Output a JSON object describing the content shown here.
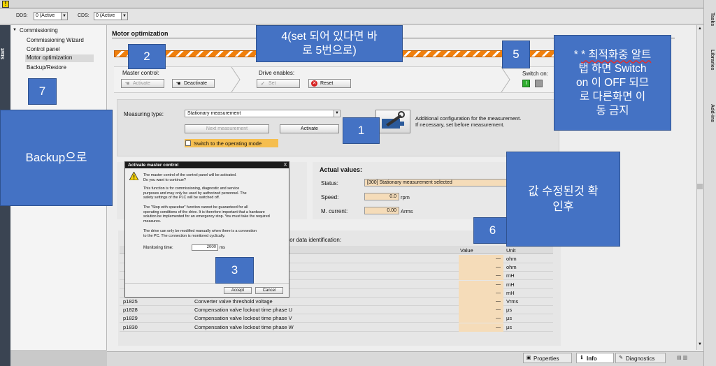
{
  "dds": {
    "label": "DDS:",
    "value": "0 (Active"
  },
  "cds": {
    "label": "CDS:",
    "value": "0 (Active"
  },
  "start_label": "Start",
  "nav": {
    "root": "Commissioning",
    "items": [
      "Commissioning Wizard",
      "Control panel",
      "Motor optimization",
      "Backup/Restore"
    ],
    "selected_index": 2
  },
  "main": {
    "title": "Motor optimization",
    "master_control_label": "Master control:",
    "activate_label": "Activate",
    "deactivate_label": "Deactivate",
    "drive_enables_label": "Drive enables:",
    "set_label": "Set",
    "reset_label": "Reset",
    "switch_on_label": "Switch on:"
  },
  "measurement": {
    "measuring_type_label": "Measuring type:",
    "measuring_type_value": "Stationary measurement",
    "next_measurement_label": "Next measurement",
    "activate_label": "Activate",
    "switch_operating_label": "Switch to the operating mode",
    "info_line1": "Additional configuration for the measurement.",
    "info_line2": "If necessary, set before measurement."
  },
  "actual": {
    "heading": "Actual values:",
    "status_label": "Status:",
    "status_value": "[300] Stationary measurement selected",
    "speed_label": "Speed:",
    "speed_value": "0.0",
    "speed_unit": "rpm",
    "current_label": "M. current:",
    "current_value": "0.00",
    "current_unit": "Arms"
  },
  "table": {
    "partial_heading": "tor data identification:",
    "col_value": "Value",
    "col_unit": "Unit",
    "rows": [
      {
        "param": "",
        "desc": "",
        "value": "—",
        "unit": "ohm"
      },
      {
        "param": "",
        "desc": "",
        "value": "—",
        "unit": "ohm"
      },
      {
        "param": "",
        "desc": "",
        "value": "—",
        "unit": "mH"
      },
      {
        "param": "",
        "desc": "",
        "value": "—",
        "unit": "mH"
      },
      {
        "param": "",
        "desc": "",
        "value": "—",
        "unit": "mH"
      },
      {
        "param": "p1825",
        "desc": "Converter valve threshold voltage",
        "value": "—",
        "unit": "Vrms"
      },
      {
        "param": "p1828",
        "desc": "Compensation valve lockout time phase U",
        "value": "—",
        "unit": "μs"
      },
      {
        "param": "p1829",
        "desc": "Compensation valve lockout time phase V",
        "value": "—",
        "unit": "μs"
      },
      {
        "param": "p1830",
        "desc": "Compensation valve lockout time phase W",
        "value": "—",
        "unit": "μs"
      }
    ]
  },
  "dialog": {
    "title": "Activate master control",
    "close": "X",
    "line1": "The master control of the control panel will be activated.",
    "line2": "Do you want to continue?",
    "p1a": "This function is for commissioning, diagnostic and service",
    "p1b": "purposes and may only be used by authorized personnel. The",
    "p1c": "safety settings of the PLC will be switched off.",
    "p2a": "The \"Stop with spacebar\" function cannot be guaranteed for all",
    "p2b": "operating conditions of the drive. It is therefore important that a hardware",
    "p2c": "solution be implemented for an emergency stop. You must take the required",
    "p2d": "measures.",
    "p3a": "The drive can only be modified manually when there is a connection",
    "p3b": "to the PC. The connection is monitored cyclically.",
    "monitoring_label": "Monitoring time:",
    "monitoring_value": "2000",
    "monitoring_unit": "ms",
    "accept_label": "Accept",
    "cancel_label": "Cancel"
  },
  "annotations": {
    "a2": "2",
    "a4_line1": "4(set 되어 있다면 바",
    "a4_line2": "로 5번으로)",
    "a5": "5",
    "a7": "7",
    "a1": "1",
    "a3": "3",
    "a6": "6",
    "backup": "Backup으로",
    "note_line1": "* 최적화중 알트",
    "note_line2": "탭 하면 Switch",
    "note_line3": "on 이 OFF 되므",
    "note_line4": "로 다른화면 이",
    "note_line5": "동 금지",
    "value_line1": "값 수정된것 확",
    "value_line2": "인후"
  },
  "right_tabs": [
    "Tasks",
    "Libraries",
    "Add-ins"
  ],
  "bottom": {
    "properties_label": "Properties",
    "info_label": "Info",
    "diagnostics_label": "Diagnostics"
  }
}
